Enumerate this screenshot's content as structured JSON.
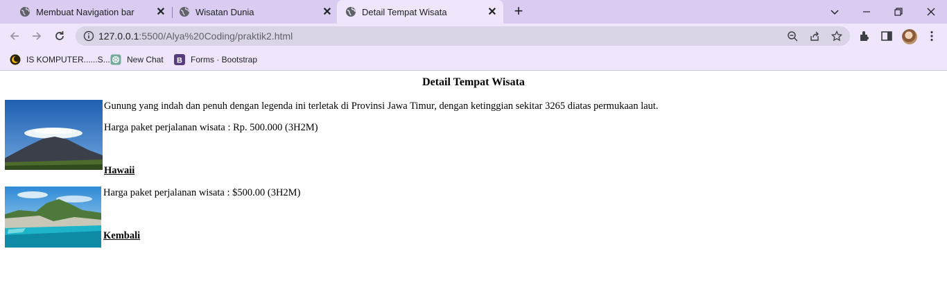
{
  "browser": {
    "tabs": [
      {
        "title": "Membuat Navigation bar",
        "active": false
      },
      {
        "title": "Wisatan Dunia",
        "active": false
      },
      {
        "title": "Detail Tempat Wisata",
        "active": true
      }
    ],
    "url": {
      "host": "127.0.0.1",
      "path": ":5500/Alya%20Coding/praktik2.html"
    },
    "bookmarks": [
      {
        "label": "IS KOMPUTER......S...",
        "icon": "crescent-logo-icon"
      },
      {
        "label": "New Chat",
        "icon": "openai-logo-icon"
      },
      {
        "label": "Forms · Bootstrap",
        "icon": "bootstrap-logo-icon"
      }
    ],
    "accent": "#d9ccf0"
  },
  "page": {
    "title": "Detail Tempat Wisata",
    "destinations": [
      {
        "image": "mountain-photo",
        "description": "Gunung yang indah dan penuh dengan legenda ini terletak di Provinsi Jawa Timur, dengan ketinggian sekitar 3265 diatas permukaan laut.",
        "price": "Harga paket perjalanan wisata : Rp. 500.000 (3H2M)",
        "link": "Hawaii"
      },
      {
        "image": "hawaii-coast-photo",
        "price": "Harga paket perjalanan wisata : $500.00 (3H2M)",
        "link": "Kembali"
      }
    ]
  }
}
